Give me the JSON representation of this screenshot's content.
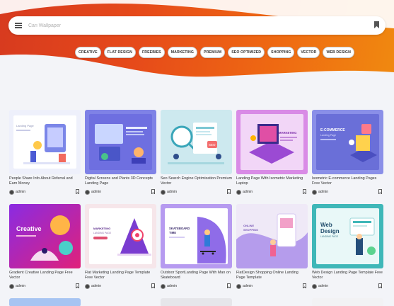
{
  "search": {
    "placeholder": "Cari Wallpaper"
  },
  "categories": [
    "CREATIVE",
    "FLAT DESIGN",
    "FREEBIES",
    "MARKETING",
    "PREMIUM",
    "SEO OPTIMIZED",
    "SHOPPING",
    "VECTOR",
    "WEB DESIGN"
  ],
  "colors": {
    "accent_start": "#d73a1f",
    "accent_end": "#f08a10",
    "page_bg": "#f3f4f8"
  },
  "cards": [
    {
      "title": "People Share Info About Referral and Earn Money",
      "author": "admin",
      "thumb_icon": "referral-illustration-icon"
    },
    {
      "title": "Digital Screens and Plants 3D Concepts Landing Page",
      "author": "admin",
      "thumb_icon": "digital-screens-illustration-icon"
    },
    {
      "title": "Seo Search Engine Optimization Premium Vector",
      "author": "admin",
      "thumb_icon": "seo-illustration-icon"
    },
    {
      "title": "Landing Page With Isometric Marketing Laptop",
      "author": "admin",
      "thumb_icon": "marketing-laptop-illustration-icon"
    },
    {
      "title": "Isometric E-commerce Landing Pages Free Vector",
      "author": "admin",
      "thumb_icon": "ecommerce-illustration-icon"
    },
    {
      "title": "Gradient Creative Landing Page Free Vector",
      "author": "admin",
      "thumb_icon": "creative-illustration-icon"
    },
    {
      "title": "Flat Marketing Landing Page Template Free Vector",
      "author": "admin",
      "thumb_icon": "flat-marketing-illustration-icon"
    },
    {
      "title": "Outdoor SportLanding Page With Man on Skateboard",
      "author": "admin",
      "thumb_icon": "skateboard-illustration-icon"
    },
    {
      "title": "FlatDesign Shopping Online Landing Page Template",
      "author": "admin",
      "thumb_icon": "shopping-illustration-icon"
    },
    {
      "title": "Web Design Landing Page Template Free Vector",
      "author": "admin",
      "thumb_icon": "web-design-illustration-icon"
    }
  ],
  "thumb_text": {
    "c1": "Landing Page",
    "c3": "SEO",
    "c4": "MARKETING",
    "c5a": "E-COMMERCE",
    "c5b": "Landing Page",
    "c6": "Creative",
    "c7a": "MARKETING",
    "c7b": "LANDING PAGE",
    "c8a": "SKATEBOARD",
    "c8b": "TIME",
    "c9a": "ONLINE",
    "c9b": "SHOPPING",
    "c10a": "Web",
    "c10b": "Design",
    "c10c": "LANDING PAGE"
  }
}
